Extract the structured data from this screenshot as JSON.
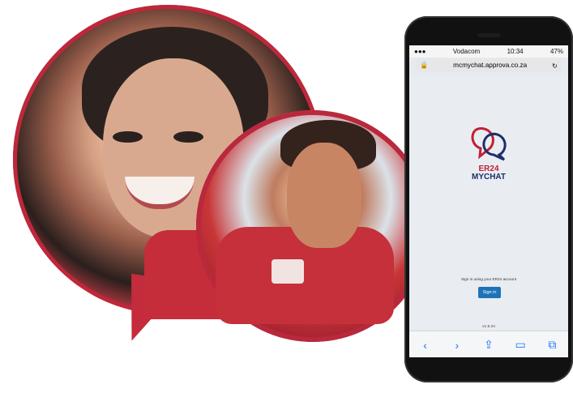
{
  "phone": {
    "carrier": "Vodacom",
    "time": "10:34",
    "battery": "47%",
    "url": "mcmychat.approva.co.za"
  },
  "app": {
    "brand_top": "ER24",
    "brand_bottom": "MYCHAT",
    "signin_caption": "Sign in using your ER24 account",
    "signin_button": "Sign in",
    "version": "v1.8.34"
  },
  "toolbar": {
    "back_icon": "chevron-left-icon",
    "forward_icon": "chevron-right-icon",
    "share_icon": "share-icon",
    "bookmarks_icon": "book-icon",
    "tabs_icon": "tabs-icon"
  },
  "colors": {
    "brand_red": "#c21f34",
    "brand_blue": "#1c2f67",
    "button_blue": "#1e73b8"
  }
}
